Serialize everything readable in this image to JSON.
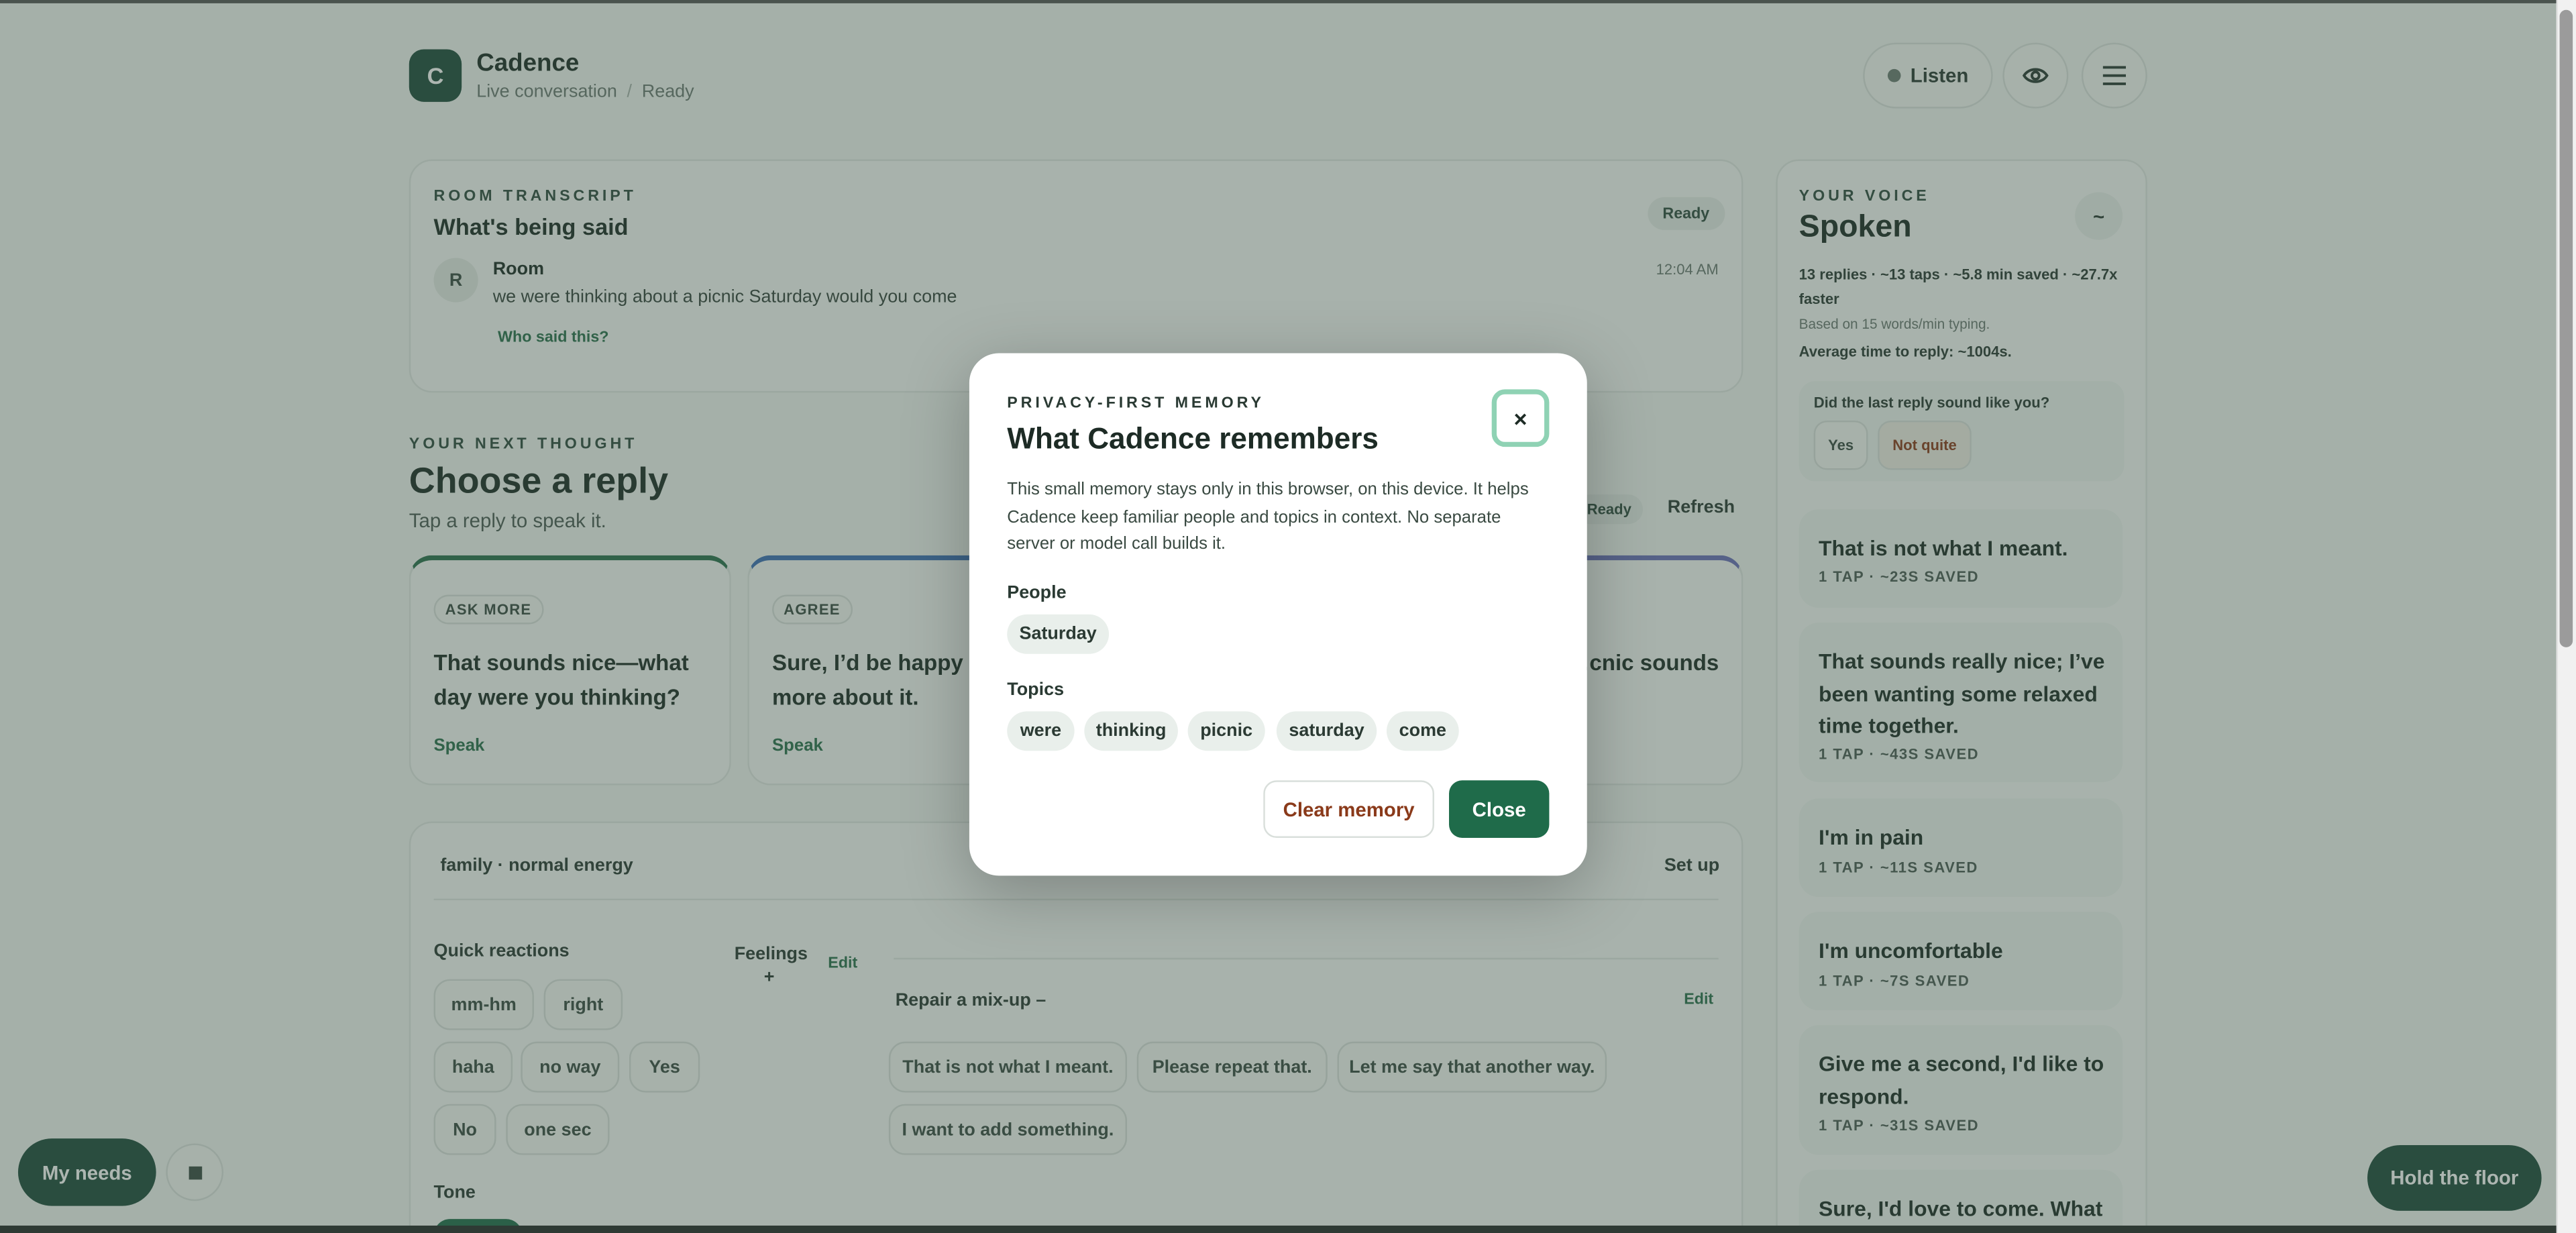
{
  "app": {
    "logo_letter": "C",
    "title": "Cadence",
    "subtitle": "Live conversation",
    "separator": "/",
    "status": "Ready"
  },
  "header": {
    "listen_label": "Listen",
    "listen_dot_color": "#6b7a73",
    "eye_icon": "eye-icon",
    "menu_icon": "menu-icon"
  },
  "transcript": {
    "eyebrow": "ROOM TRANSCRIPT",
    "title": "What's being said",
    "status_badge": "Ready",
    "entry": {
      "avatar": "R",
      "speaker": "Room",
      "text": "we were thinking about a picnic Saturday would you come",
      "time": "12:04 AM",
      "who_link": "Who said this?"
    }
  },
  "next_thought": {
    "eyebrow": "YOUR NEXT THOUGHT",
    "title": "Choose a reply",
    "subtitle": "Tap a reply to speak it.",
    "status": "Ready",
    "refresh_label": "Refresh",
    "cards": [
      {
        "tag": "ASK MORE",
        "text": "That sounds nice—what day were you thinking?",
        "speak": "Speak",
        "accent": "#2a6e4d"
      },
      {
        "tag": "AGREE",
        "text": "Sure, I’d be happy t… more about it.",
        "speak": "Speak",
        "accent": "#3d6fb6"
      },
      {
        "tag": "",
        "text": "…cnic sounds",
        "speak": "",
        "accent": "#6a6fb8"
      }
    ]
  },
  "controls": {
    "context_label": "family · normal energy",
    "setup_label": "Set up",
    "quick_reactions": {
      "label": "Quick reactions",
      "items": [
        "mm-hm",
        "right",
        "haha",
        "no way",
        "Yes",
        "No",
        "one sec"
      ]
    },
    "feelings": {
      "label": "Feelings",
      "plus": "+",
      "edit": "Edit"
    },
    "repair": {
      "label": "Repair a mix-up –",
      "edit": "Edit",
      "items": [
        "That is not what I meant.",
        "Please repeat that.",
        "Let me say that another way.",
        "I want to add something."
      ]
    },
    "tone_label": "Tone"
  },
  "voice_panel": {
    "eyebrow": "YOUR VOICE",
    "title": "Spoken",
    "toggle_label": "~",
    "stats": "13 replies · ~13 taps · ~5.8 min saved · ~27.7x faster",
    "basis": "Based on 15 words/min typing.",
    "avg_time": "Average time to reply: ~1004s.",
    "feedback": {
      "question": "Did the last reply sound like you?",
      "yes": "Yes",
      "not_quite": "Not quite"
    },
    "history": [
      {
        "text": "That is not what I meant.",
        "meta": "1 TAP · ~23S SAVED"
      },
      {
        "text": "That sounds really nice; I’ve been wanting some relaxed time together.",
        "meta": "1 TAP · ~43S SAVED"
      },
      {
        "text": "I'm in pain",
        "meta": "1 TAP · ~11S SAVED"
      },
      {
        "text": "I'm uncomfortable",
        "meta": "1 TAP · ~7S SAVED"
      },
      {
        "text": "Give me a second, I'd like to respond.",
        "meta": "1 TAP · ~31S SAVED"
      },
      {
        "text": "Sure, I'd love to come. What",
        "meta": ""
      }
    ]
  },
  "floating": {
    "my_needs": "My needs",
    "stop_icon": "stop-icon",
    "hold_floor": "Hold the floor"
  },
  "modal": {
    "eyebrow": "PRIVACY-FIRST MEMORY",
    "title": "What Cadence remembers",
    "close_x": "×",
    "description": "This small memory stays only in this browser, on this device. It helps Cadence keep familiar people and topics in context. No separate server or model call builds it.",
    "people_label": "People",
    "people": [
      "Saturday"
    ],
    "topics_label": "Topics",
    "topics": [
      "were",
      "thinking",
      "picnic",
      "saturday",
      "come"
    ],
    "clear_label": "Clear memory",
    "close_label": "Close"
  },
  "colors": {
    "brand": "#1f6b4a",
    "dark_green": "#1e4a3b",
    "danger_text": "#8a3a1a",
    "background": "#f2f4f1"
  }
}
